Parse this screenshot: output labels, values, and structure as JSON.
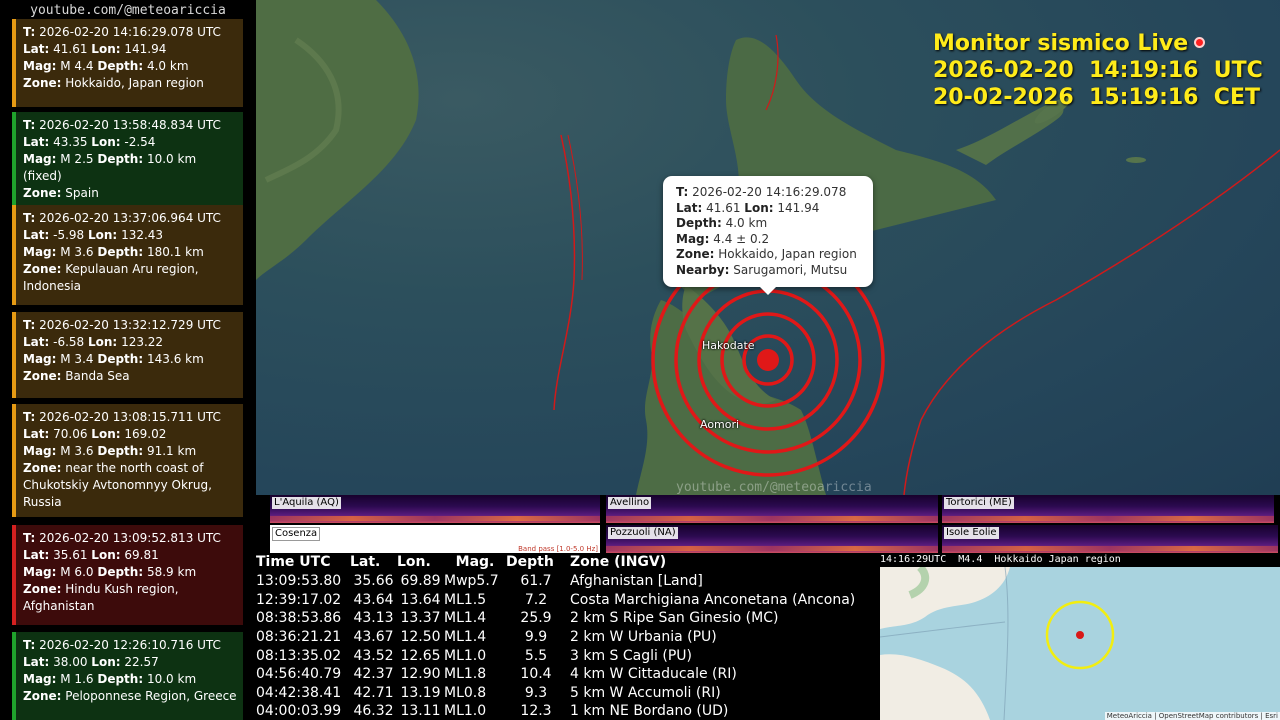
{
  "sidebar": {
    "channel": "youtube.com/@meteoariccia",
    "cards": [
      {
        "t": "2026-02-20  14:16:29.078 UTC",
        "lat": "41.61",
        "lon": "141.94",
        "mag": "M 4.4",
        "depth": "4.0 km",
        "zone": "Hokkaido, Japan region",
        "bg": "#3b2a0c",
        "accent": "#e59a14"
      },
      {
        "t": "2026-02-20  13:58:48.834 UTC",
        "lat": "43.35",
        "lon": "-2.54",
        "mag": "M 2.5",
        "depth": "10.0 km (fixed)",
        "zone": "Spain",
        "bg": "#0d3212",
        "accent": "#1fa22c"
      },
      {
        "t": "2026-02-20  13:37:06.964 UTC",
        "lat": "-5.98",
        "lon": "132.43",
        "mag": "M 3.6",
        "depth": "180.1 km",
        "zone": "Kepulauan Aru region, Indonesia",
        "bg": "#3b2a0c",
        "accent": "#e59a14"
      },
      {
        "t": "2026-02-20  13:32:12.729 UTC",
        "lat": "-6.58",
        "lon": "123.22",
        "mag": "M 3.4",
        "depth": "143.6 km",
        "zone": "Banda Sea",
        "bg": "#3b2a0c",
        "accent": "#e59a14"
      },
      {
        "t": "2026-02-20  13:08:15.711 UTC",
        "lat": "70.06",
        "lon": "169.02",
        "mag": "M 3.6",
        "depth": "91.1 km",
        "zone": "near the north coast of Chukotskiy Avtonomnyy Okrug, Russia",
        "bg": "#3b2a0c",
        "accent": "#e59a14"
      },
      {
        "t": "2026-02-20  13:09:52.813 UTC",
        "lat": "35.61",
        "lon": "69.81",
        "mag": "M 6.0",
        "depth": "58.9 km",
        "zone": "Hindu Kush region, Afghanistan",
        "bg": "#3d0b0b",
        "accent": "#d42020"
      },
      {
        "t": "2026-02-20  12:26:10.716 UTC",
        "lat": "38.00",
        "lon": "22.57",
        "mag": "M 1.6",
        "depth": "10.0 km",
        "zone": "Peloponnese Region, Greece",
        "bg": "#0d3212",
        "accent": "#1fa22c"
      }
    ]
  },
  "labels": {
    "t": "T:",
    "lat": "Lat:",
    "lon": "Lon:",
    "mag": "Mag:",
    "depth": "Depth:",
    "zone": "Zone:",
    "nearby": "Nearby:"
  },
  "monitor": {
    "title": "Monitor sismico Live",
    "utc": "2026-02-20  14:19:16  UTC",
    "cet": "20-02-2026  15:19:16  CET"
  },
  "popup": {
    "t": "2026-02-20  14:16:29.078",
    "lat": "41.61",
    "lon": "141.94",
    "depth": "4.0 km",
    "mag": "4.4 ± 0.2",
    "zone": "Hokkaido, Japan region",
    "nearby": "Sarugamori, Mutsu"
  },
  "map": {
    "places": {
      "hakodate": "Hakodate",
      "aomori": "Aomori"
    },
    "watermark": "youtube.com/@meteoariccia",
    "colors": {
      "sea": "#25465a",
      "land": "#4b6a45",
      "epicenter": "#e01818",
      "fault": "#d01a1a"
    }
  },
  "stations": {
    "laquila": "L'Aquila (AQ)",
    "avellino": "Avellino",
    "tortorici": "Tortorici (ME)",
    "cosenza": "Cosenza",
    "pozzuoli": "Pozzuoli (NA)",
    "eolie": "Isole Eolie",
    "bandpass": "Band pass [1.0-5.0 Hz]"
  },
  "events": {
    "headers": {
      "time": "Time UTC",
      "lat": "Lat.",
      "lon": "Lon.",
      "mag": "Mag.",
      "depth": "Depth",
      "zone": "Zone (INGV)"
    },
    "rows": [
      {
        "time": "13:09:53.80",
        "lat": "35.66",
        "lon": "69.89",
        "mag": "Mwp5.7",
        "depth": "61.7",
        "zone": "Afghanistan [Land]"
      },
      {
        "time": "12:39:17.02",
        "lat": "43.64",
        "lon": "13.64",
        "mag": "ML1.5",
        "depth": "7.2",
        "zone": "Costa Marchigiana Anconetana (Ancona)"
      },
      {
        "time": "08:38:53.86",
        "lat": "43.13",
        "lon": "13.37",
        "mag": "ML1.4",
        "depth": "25.9",
        "zone": "2 km S Ripe San Ginesio (MC)"
      },
      {
        "time": "08:36:21.21",
        "lat": "43.67",
        "lon": "12.50",
        "mag": "ML1.4",
        "depth": "9.9",
        "zone": "2 km W Urbania (PU)"
      },
      {
        "time": "08:13:35.02",
        "lat": "43.52",
        "lon": "12.65",
        "mag": "ML1.0",
        "depth": "5.5",
        "zone": "3 km S Cagli (PU)"
      },
      {
        "time": "04:56:40.79",
        "lat": "42.37",
        "lon": "12.90",
        "mag": "ML1.8",
        "depth": "10.4",
        "zone": "4 km W Cittaducale (RI)"
      },
      {
        "time": "04:42:38.41",
        "lat": "42.71",
        "lon": "13.19",
        "mag": "ML0.8",
        "depth": "9.3",
        "zone": "5 km W Accumoli (RI)"
      },
      {
        "time": "04:00:03.99",
        "lat": "46.32",
        "lon": "13.11",
        "mag": "ML1.0",
        "depth": "12.3",
        "zone": "1 km NE Bordano (UD)"
      }
    ]
  },
  "minimap": {
    "header": "14:16:29UTC  M4.4  Hokkaido Japan region",
    "attribution": "MeteoAriccia | OpenStreetMap contributors | Esri"
  }
}
